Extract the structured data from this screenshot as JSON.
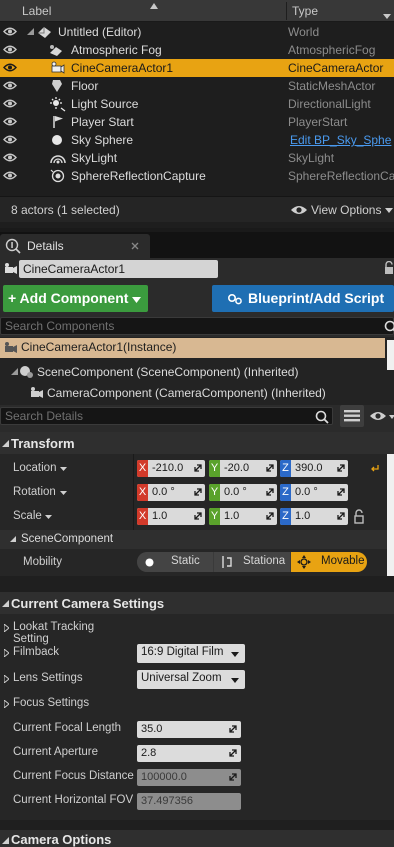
{
  "outliner": {
    "columns": {
      "label": "Label",
      "type": "Type"
    },
    "rows": [
      {
        "label": "Untitled (Editor)",
        "type": "World"
      },
      {
        "label": "Atmospheric Fog",
        "type": "AtmosphericFog"
      },
      {
        "label": "CineCameraActor1",
        "type": "CineCameraActor"
      },
      {
        "label": "Floor",
        "type": "StaticMeshActor"
      },
      {
        "label": "Light Source",
        "type": "DirectionalLight"
      },
      {
        "label": "Player Start",
        "type": "PlayerStart"
      },
      {
        "label": "Sky Sphere",
        "type": "Edit BP_Sky_Sphe"
      },
      {
        "label": "SkyLight",
        "type": "SkyLight"
      },
      {
        "label": "SphereReflectionCapture",
        "type": "SphereReflectionCa"
      }
    ],
    "status": "8 actors (1 selected)",
    "view_options": "View Options"
  },
  "details": {
    "tab_label": "Details",
    "actor_name": "CineCameraActor1",
    "add_component": "+ Add Component",
    "blueprint_script": "Blueprint/Add Script",
    "search_components_placeholder": "Search Components",
    "instance_label": "CineCameraActor1(Instance)",
    "component_root": "SceneComponent (SceneComponent) (Inherited)",
    "component_child": "CameraComponent (CameraComponent) (Inherited)",
    "search_details_placeholder": "Search Details"
  },
  "transform": {
    "title": "Transform",
    "location": {
      "label": "Location",
      "x": "-210.0",
      "y": "-20.0",
      "z": "390.0"
    },
    "rotation": {
      "label": "Rotation",
      "x": "0.0 °",
      "y": "0.0 °",
      "z": "0.0 °"
    },
    "scale": {
      "label": "Scale",
      "x": "1.0",
      "y": "1.0",
      "z": "1.0"
    },
    "axis": {
      "x": "X",
      "y": "Y",
      "z": "Z"
    }
  },
  "scene_component": {
    "title": "SceneComponent",
    "mobility_label": "Mobility",
    "static": "Static",
    "stationary": "Stationa",
    "movable": "Movable"
  },
  "camera_settings": {
    "title": "Current Camera Settings",
    "lookat": "Lookat Tracking Setting",
    "filmback": "Filmback",
    "filmback_value": "16:9 Digital Film",
    "lens": "Lens Settings",
    "lens_value": "Universal Zoom",
    "focus": "Focus Settings",
    "focal_length_label": "Current Focal Length",
    "focal_length": "35.0",
    "aperture_label": "Current Aperture",
    "aperture": "2.8",
    "focus_distance_label": "Current Focus Distance",
    "focus_distance": "100000.0",
    "hfov_label": "Current Horizontal FOV",
    "hfov": "37.497356"
  },
  "camera_options": {
    "title": "Camera Options"
  },
  "colors": {
    "selection": "#e8a312",
    "add_component": "#3b9b3e",
    "blueprint": "#1f6fb3",
    "link": "#4a9aef"
  }
}
